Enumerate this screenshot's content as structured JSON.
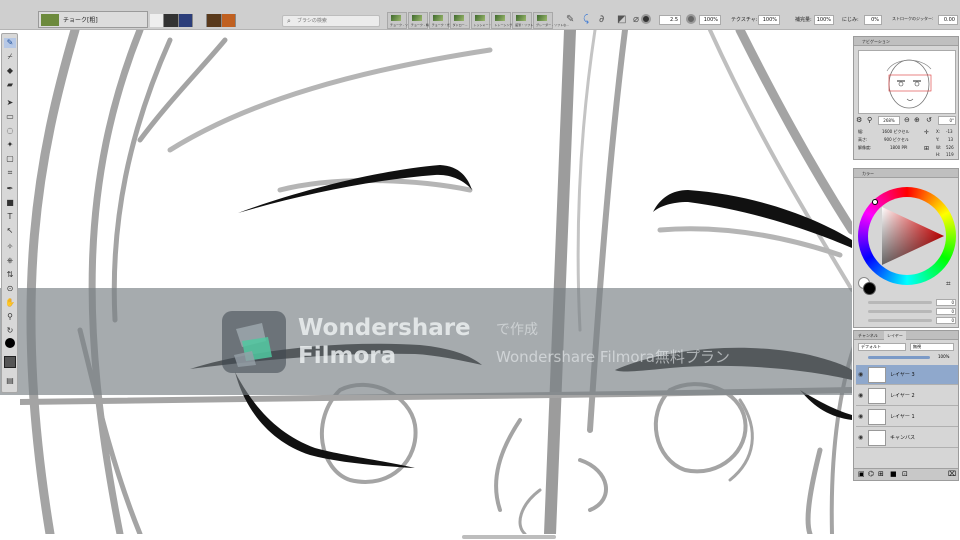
{
  "top_bar": {
    "preset_name": "チョーク[粗]",
    "search_placeholder": "ブラシの検索",
    "brush_presets": [
      "チョーク - ソフトな太...",
      "チョーク - 精...",
      "チョーク・光...",
      "ダドロー...",
      "レッシャー・ソフトな...",
      "トレーシング...",
      "鉛筆・ソフトな...",
      "グレーダー - ソフトな..."
    ],
    "size_value": "2.5",
    "opacity_value": "100%",
    "texture_label": "テクスチャ:",
    "texture_value": "100%",
    "blend_label": "補完量:",
    "blend_value": "100%",
    "bleed_label": "にじみ:",
    "bleed_value": "0%",
    "jitter_label": "ストロークのジッター:",
    "jitter_value": "0.00"
  },
  "navigator": {
    "title": "ナビゲーション",
    "zoom": "268%",
    "rotation": "0°",
    "width_label": "幅:",
    "width_value": "1600 ピクセル",
    "height_label": "高さ:",
    "height_value": "900 ピクセル",
    "resolution_label": "解像度:",
    "resolution_value": "1800 PPI",
    "x_label": "X:",
    "x_value": "-13",
    "y_label": "Y:",
    "y_value": "13",
    "w_label": "W:",
    "w_value": "526",
    "h_label": "H:",
    "h_value": "119"
  },
  "color_panel": {
    "title": "カラー",
    "slider_values": [
      "0",
      "0",
      "0"
    ]
  },
  "layers_panel": {
    "tab_channels": "チャンネル",
    "tab_layers": "レイヤー",
    "composite_method": "デフォルト",
    "composite_depth": "無視",
    "opacity": "100%",
    "layers": [
      "レイヤー 3",
      "レイヤー 2",
      "レイヤー 1",
      "キャンバス"
    ]
  },
  "watermark": {
    "brand_line1": "Wondershare",
    "brand_line2": "Filmora",
    "made_with": "で作成",
    "plan": "Wondershare Filmora無料プラン"
  },
  "colors": {
    "accent_blue": "#8fa8cc",
    "ink": "#111111",
    "sketch_gray": "#a0a0a0"
  }
}
